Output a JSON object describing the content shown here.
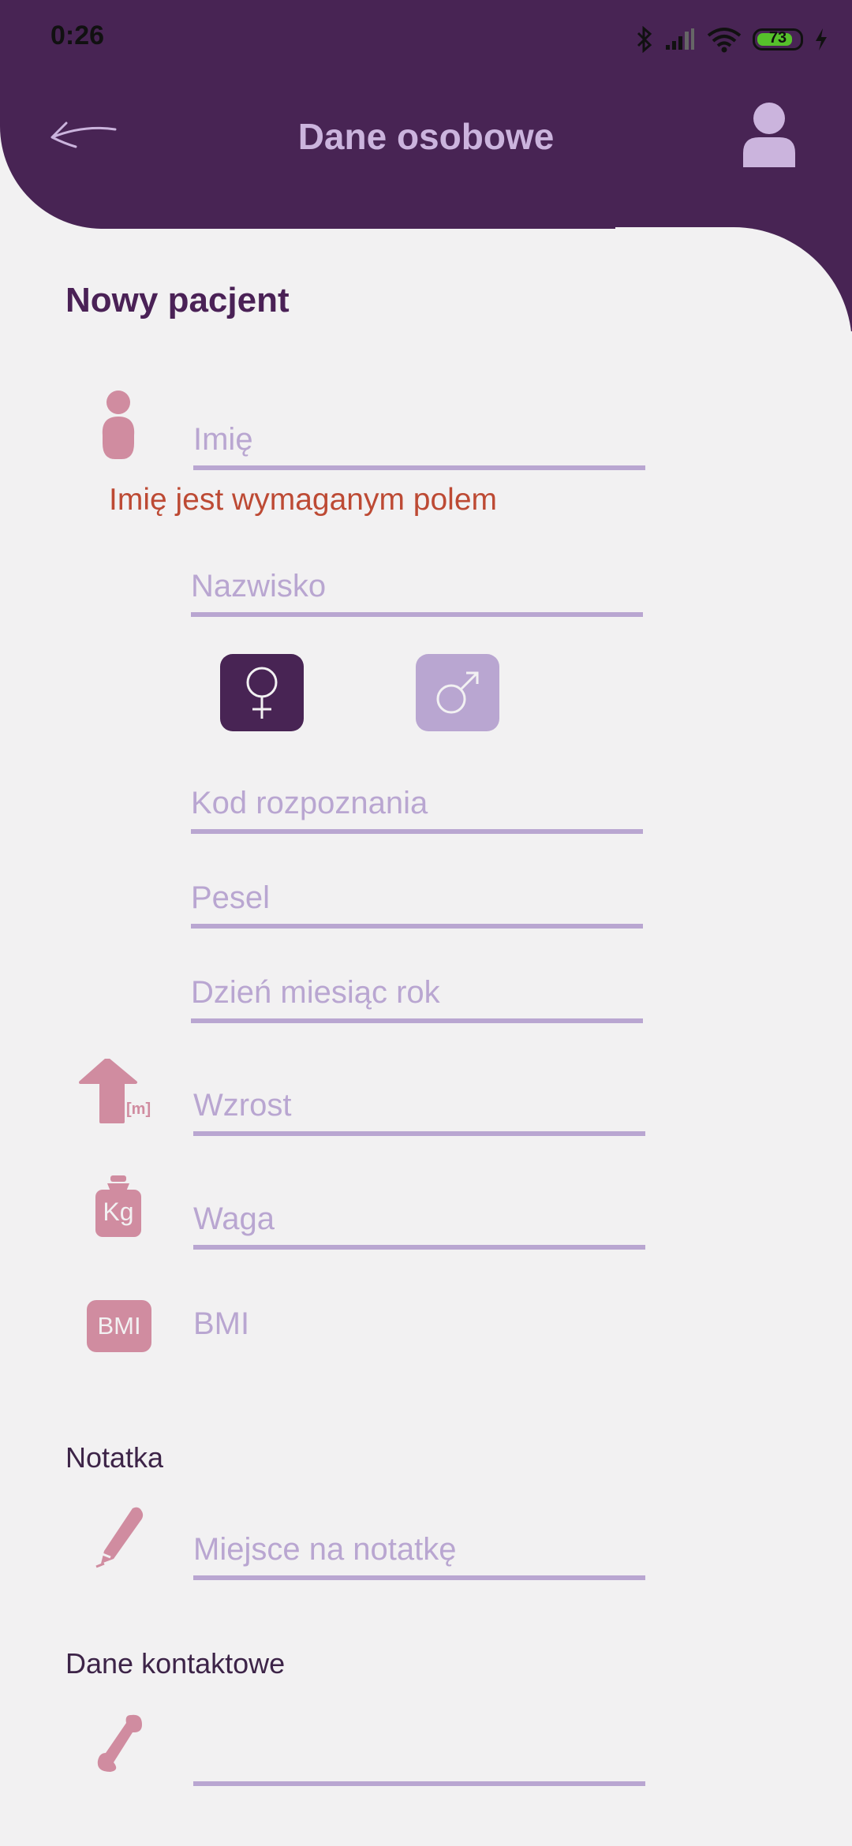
{
  "status_bar": {
    "time": "0:26",
    "battery_level": "73"
  },
  "header": {
    "title": "Dane osobowe",
    "back_icon": "arrow-left-icon",
    "profile_icon": "user-icon"
  },
  "form": {
    "heading": "Nowy pacjent",
    "first_name": {
      "placeholder": "Imię",
      "error": "Imię jest wymaganym polem"
    },
    "last_name": {
      "placeholder": "Nazwisko"
    },
    "gender": {
      "selected": "female",
      "female_icon": "female-symbol-icon",
      "male_icon": "male-symbol-icon"
    },
    "diagnosis_code": {
      "placeholder": "Kod rozpoznania"
    },
    "pesel": {
      "placeholder": "Pesel"
    },
    "birth_date": {
      "placeholder": "Dzień miesiąc rok"
    },
    "height": {
      "placeholder": "Wzrost",
      "unit": "[m]"
    },
    "weight": {
      "placeholder": "Waga",
      "unit": "Kg"
    },
    "bmi": {
      "badge": "BMI",
      "value": "BMI"
    },
    "note": {
      "label": "Notatka",
      "placeholder": "Miejsce na notatkę"
    },
    "contact": {
      "label": "Dane kontaktowe",
      "placeholder": ""
    }
  },
  "colors": {
    "primary": "#482454",
    "accent_light": "#cbb4dd",
    "line": "#b9a6d1",
    "icon_pink": "#d08ca0",
    "error": "#bd4a34"
  }
}
